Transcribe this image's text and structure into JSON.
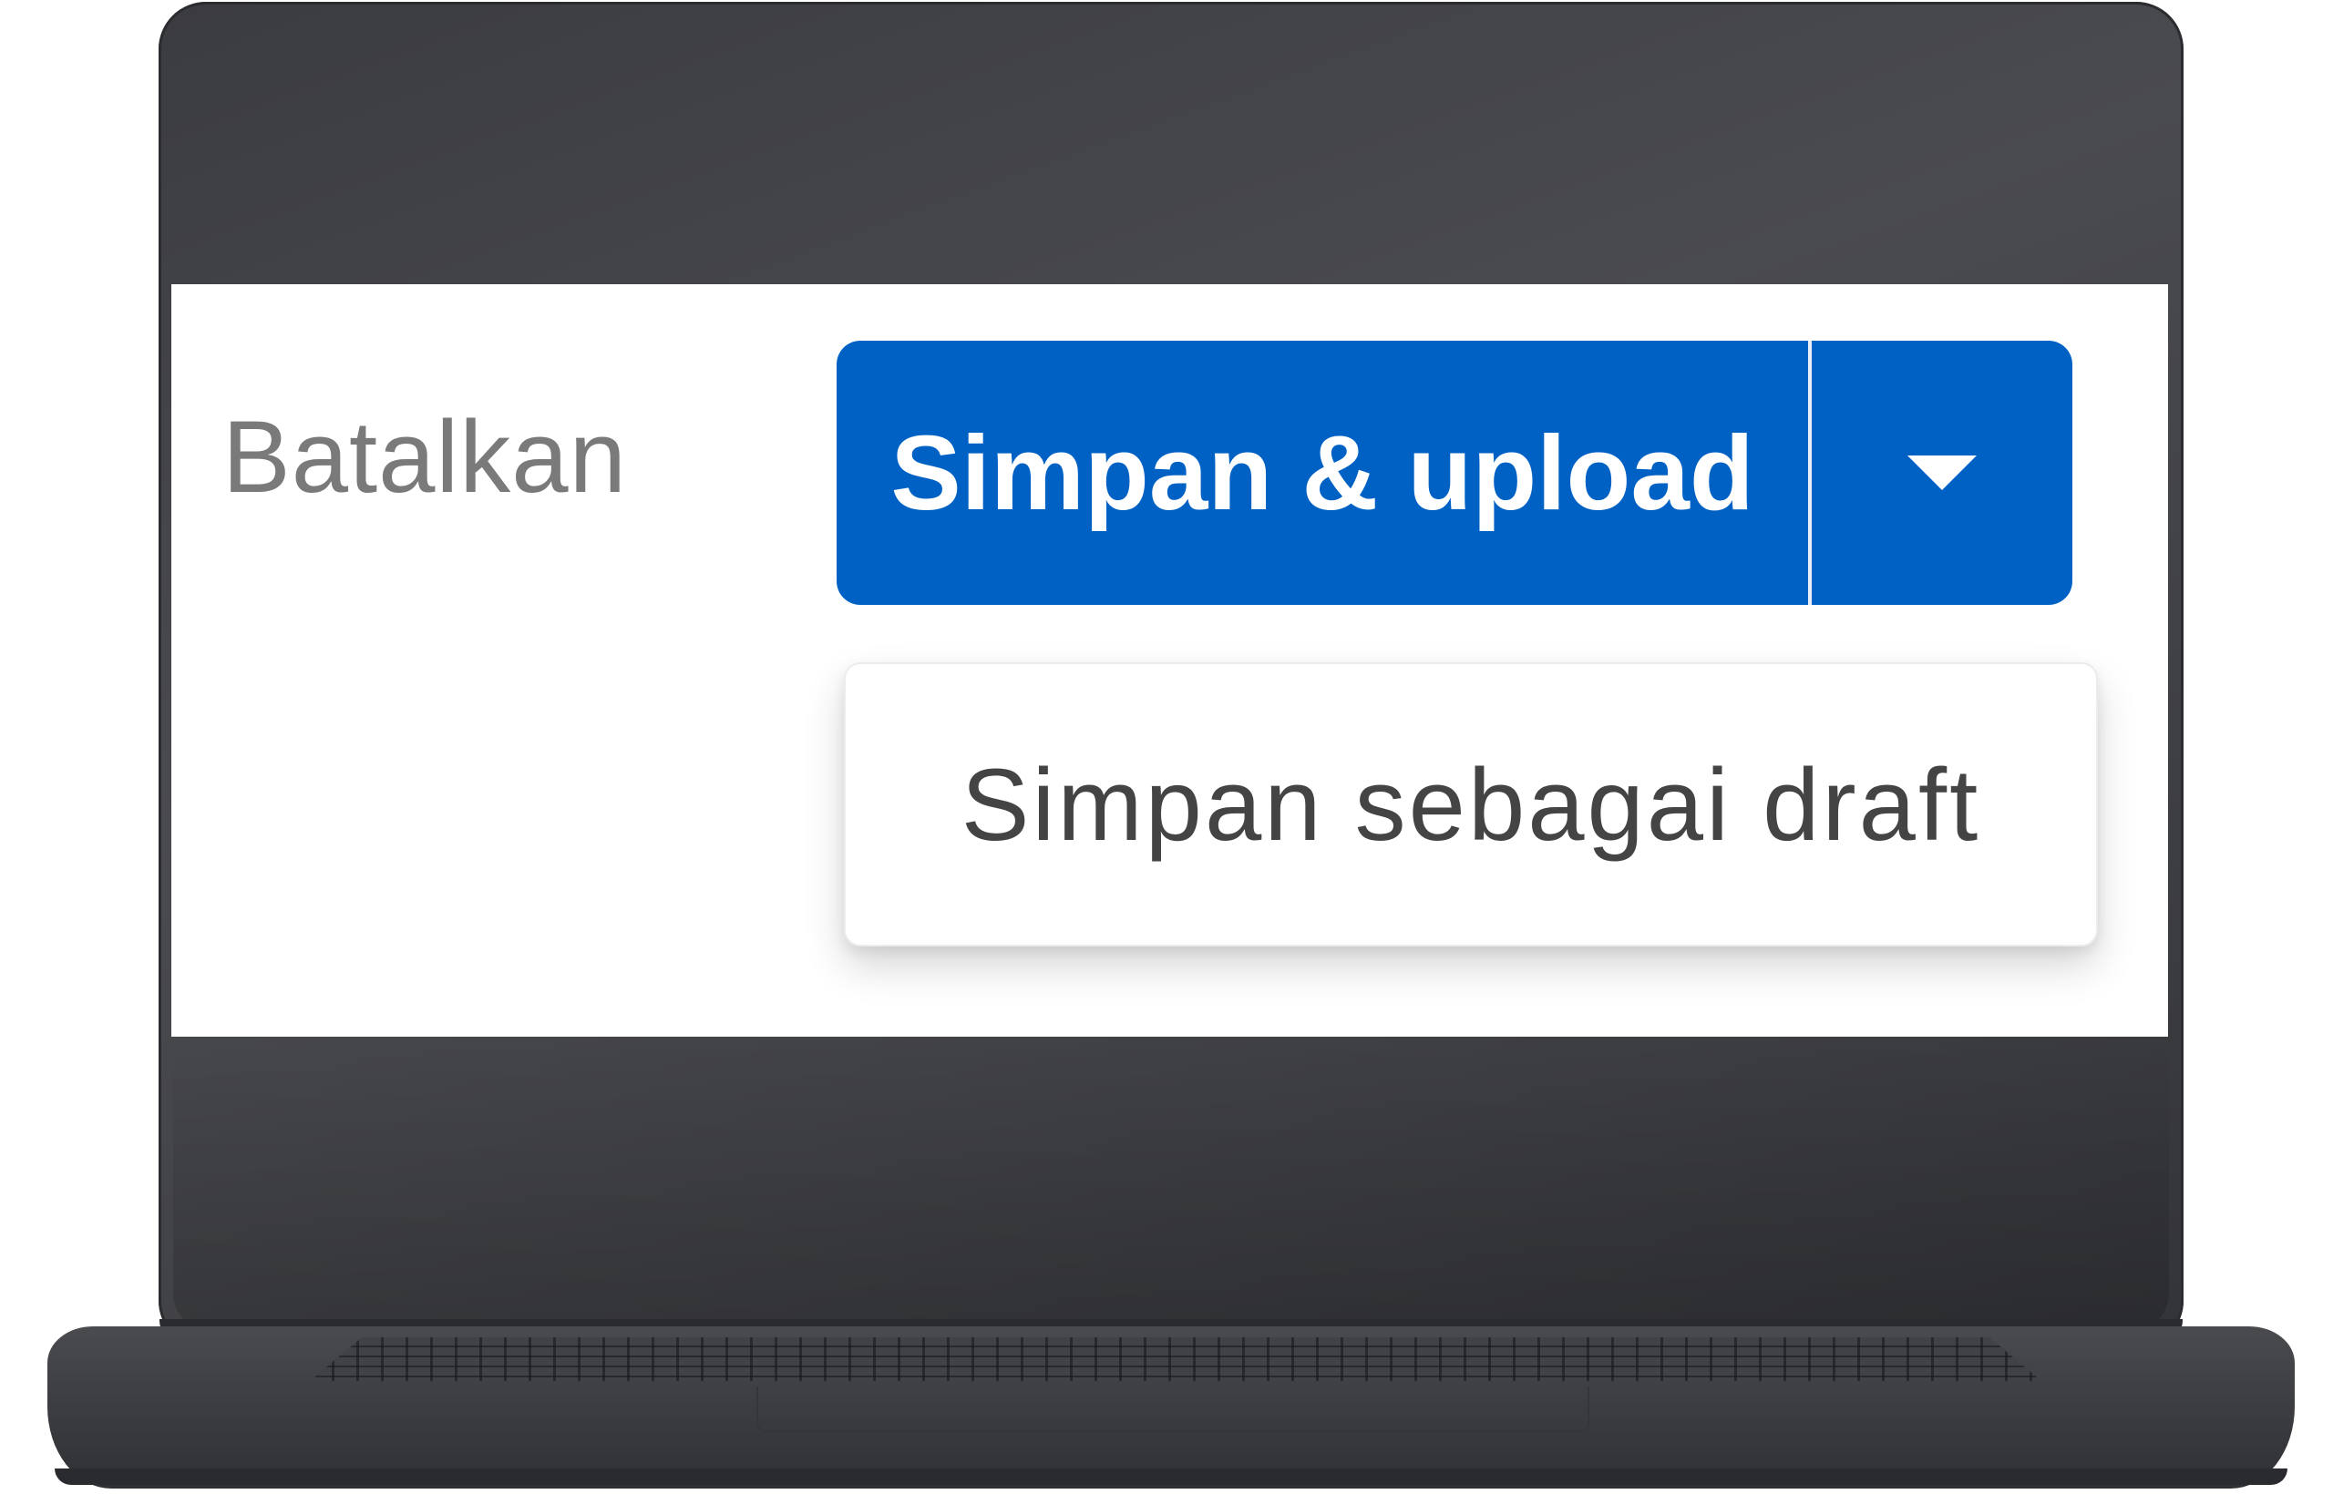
{
  "cancel": {
    "label": "Batalkan"
  },
  "primary_action": {
    "label": "Simpan & upload",
    "toggle_icon": "caret-down-icon"
  },
  "dropdown": {
    "items": [
      {
        "label": "Simpan sebagai draft"
      }
    ]
  },
  "colors": {
    "primary": "#0061c5",
    "bezel": "#434448",
    "cancel_text": "#7a7a7a",
    "menu_text": "#444444"
  }
}
